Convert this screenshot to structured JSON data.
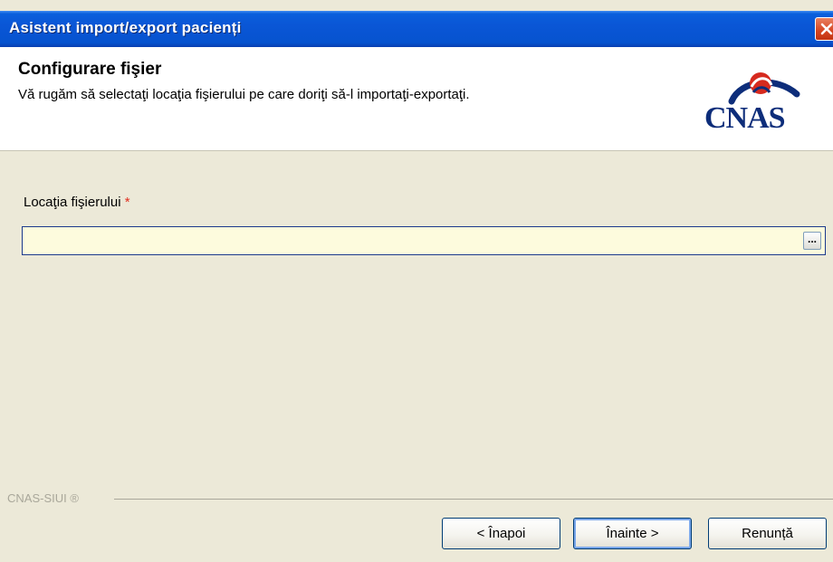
{
  "window": {
    "title": "Asistent import/export pacienți"
  },
  "header": {
    "heading": "Configurare fişier",
    "subheading": "Vă rugăm să selectaţi locaţia fişierului pe care doriţi să-l importaţi-exportaţi.",
    "logo_text": "CNAS"
  },
  "form": {
    "file_location_label": "Locaţia fişierului",
    "required_marker": "*",
    "file_location_value": "",
    "browse_label": "..."
  },
  "footer": {
    "brand": "CNAS-SIUI ®"
  },
  "buttons": {
    "back": "< Înapoi",
    "next": "Înainte >",
    "cancel": "Renunță"
  },
  "colors": {
    "titlebar": "#0a56d6",
    "dialog_background": "#ECE9D8",
    "input_background": "#fdfbdd",
    "required": "#e03020",
    "logo_blue": "#0d2d7a",
    "logo_red": "#d62a1f"
  }
}
